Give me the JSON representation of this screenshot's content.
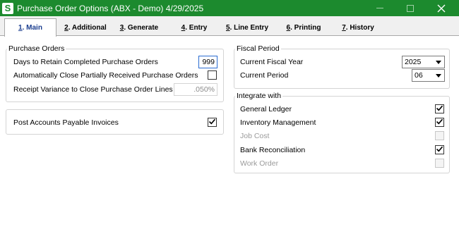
{
  "window": {
    "app_icon_letter": "S",
    "title": "Purchase Order Options (ABX - Demo) 4/29/2025",
    "close_glyph": "✕"
  },
  "tabs": [
    {
      "key": "1",
      "label": ". Main"
    },
    {
      "key": "2",
      "label": ". Additional"
    },
    {
      "key": "3",
      "label": ". Generate"
    },
    {
      "key": "4",
      "label": ". Entry"
    },
    {
      "key": "5",
      "label": ". Line Entry"
    },
    {
      "key": "6",
      "label": ". Printing"
    },
    {
      "key": "7",
      "label": ". History"
    }
  ],
  "purchase_orders": {
    "title": "Purchase Orders",
    "days_label": "Days to Retain Completed Purchase Orders",
    "days_value": "999",
    "auto_close_label": "Automatically Close Partially Received Purchase Orders",
    "auto_close_checked": false,
    "variance_label": "Receipt Variance to Close Purchase Order Lines",
    "variance_value": ".050%"
  },
  "ap_invoices": {
    "label": "Post Accounts Payable Invoices",
    "checked": true
  },
  "fiscal_period": {
    "title": "Fiscal Period",
    "year_label": "Current Fiscal Year",
    "year_value": "2025",
    "period_label": "Current Period",
    "period_value": "06"
  },
  "integrate": {
    "title": "Integrate with",
    "items": [
      {
        "label": "General Ledger",
        "checked": true,
        "enabled": true
      },
      {
        "label": "Inventory Management",
        "checked": true,
        "enabled": true
      },
      {
        "label": "Job Cost",
        "checked": false,
        "enabled": false
      },
      {
        "label": "Bank Reconciliation",
        "checked": true,
        "enabled": true
      },
      {
        "label": "Work Order",
        "checked": false,
        "enabled": false
      }
    ]
  },
  "colors": {
    "titlebar": "#1c8a2e",
    "active_tab_text": "#1a3d8f",
    "disabled_text": "#9a9a9a"
  }
}
